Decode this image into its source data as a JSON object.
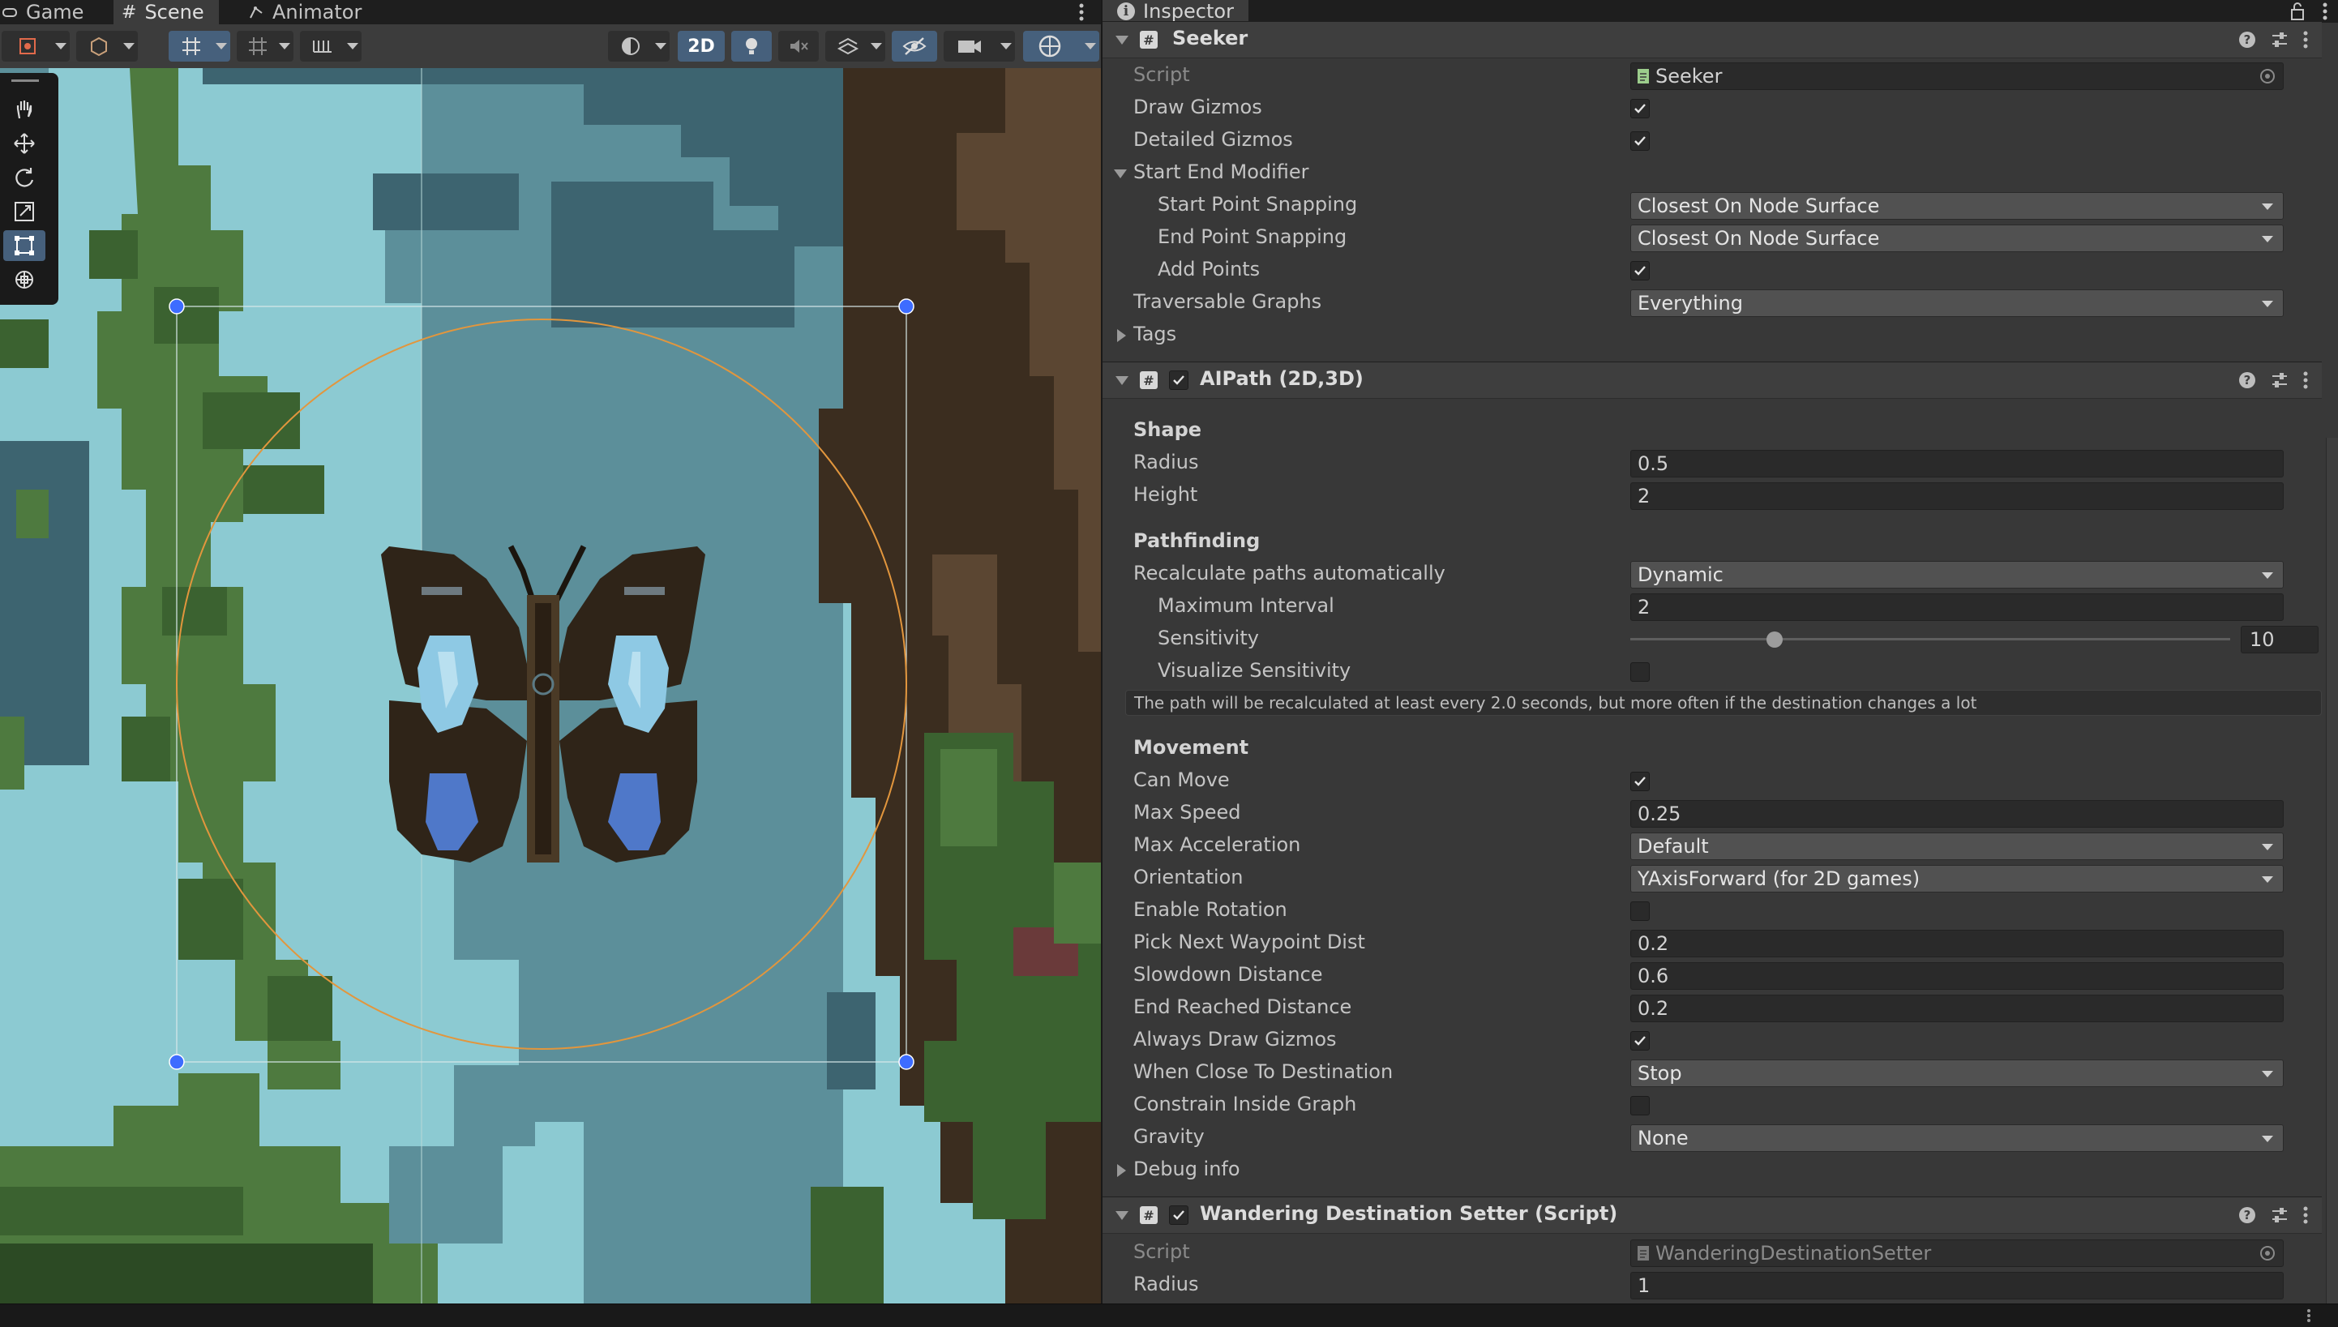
{
  "scene_panel": {
    "tabs": [
      {
        "label": "Game",
        "icon": "gamepad-icon"
      },
      {
        "label": "Scene",
        "icon": "hash-icon"
      },
      {
        "label": "Animator",
        "icon": "animator-icon"
      }
    ],
    "active_tab": "Scene",
    "toolbar": {
      "mode_2d_label": "2D",
      "buttons": [
        "draw-mode-icon",
        "shading-icon",
        "grid-snap-icon",
        "increment-snap-icon",
        "ruler-icon",
        "render-mode-icon",
        "lighting-icon",
        "audio-mute-icon",
        "effects-icon",
        "hidden-objects-icon",
        "camera-icon",
        "gizmos-icon"
      ]
    },
    "tools": [
      "hand-tool-icon",
      "move-tool-icon",
      "rotate-tool-icon",
      "scale-tool-icon",
      "rect-tool-icon",
      "transform-tool-icon"
    ],
    "active_tool": "rect-tool-icon",
    "colors": {
      "sky_light": "#8ccad2",
      "sky_mid": "#5c8f9a",
      "sky_dark": "#3d6470",
      "foliage_light": "#4e7a3f",
      "foliage_mid": "#3b6230",
      "foliage_dark": "#2c4a24",
      "trunk_dark": "#3b2d1f",
      "trunk_mid": "#5b4632",
      "gizmo_circle": "#e2963d",
      "handle_blue": "#3d6cff",
      "wing_light": "#8ec9e4",
      "wing_dark": "#4f78c9",
      "wing_body": "#2f2418"
    }
  },
  "inspector": {
    "tab_label": "Inspector",
    "components": [
      {
        "title": "Seeker",
        "rows": [
          {
            "label": "Script",
            "type": "object",
            "value": "Seeker"
          },
          {
            "label": "Draw Gizmos",
            "type": "checkbox",
            "checked": true
          },
          {
            "label": "Detailed Gizmos",
            "type": "checkbox",
            "checked": true
          },
          {
            "label": "Start End Modifier",
            "type": "foldout",
            "open": true
          },
          {
            "label": "Start Point Snapping",
            "type": "dropdown",
            "value": "Closest On Node Surface",
            "indent": 1
          },
          {
            "label": "End Point Snapping",
            "type": "dropdown",
            "value": "Closest On Node Surface",
            "indent": 1
          },
          {
            "label": "Add Points",
            "type": "checkbox",
            "checked": true,
            "indent": 1
          },
          {
            "label": "Traversable Graphs",
            "type": "dropdown",
            "value": "Everything"
          },
          {
            "label": "Tags",
            "type": "foldout",
            "open": false
          }
        ]
      },
      {
        "title": "AIPath (2D,3D)",
        "enabled": true,
        "sections": [
          {
            "heading": "Shape",
            "rows": [
              {
                "label": "Radius",
                "type": "text",
                "value": "0.5"
              },
              {
                "label": "Height",
                "type": "text",
                "value": "2"
              }
            ]
          },
          {
            "heading": "Pathfinding",
            "rows": [
              {
                "label": "Recalculate paths automatically",
                "type": "dropdown",
                "value": "Dynamic"
              },
              {
                "label": "Maximum Interval",
                "type": "text",
                "value": "2",
                "indent": 1
              },
              {
                "label": "Sensitivity",
                "type": "slider",
                "value": "10",
                "fraction": 0.24,
                "indent": 1
              },
              {
                "label": "Visualize Sensitivity",
                "type": "checkbox",
                "checked": false,
                "indent": 1
              }
            ],
            "help": "The path will be recalculated at least every 2.0 seconds, but more often if the destination changes a lot"
          },
          {
            "heading": "Movement",
            "rows": [
              {
                "label": "Can Move",
                "type": "checkbox",
                "checked": true
              },
              {
                "label": "Max Speed",
                "type": "text",
                "value": "0.25"
              },
              {
                "label": "Max Acceleration",
                "type": "dropdown",
                "value": "Default"
              },
              {
                "label": "Orientation",
                "type": "dropdown",
                "value": "YAxisForward (for 2D games)"
              },
              {
                "label": "Enable Rotation",
                "type": "checkbox",
                "checked": false
              },
              {
                "label": "Pick Next Waypoint Dist",
                "type": "text",
                "value": "0.2"
              },
              {
                "label": "Slowdown Distance",
                "type": "text",
                "value": "0.6"
              },
              {
                "label": "End Reached Distance",
                "type": "text",
                "value": "0.2"
              },
              {
                "label": "Always Draw Gizmos",
                "type": "checkbox",
                "checked": true
              },
              {
                "label": "When Close To Destination",
                "type": "dropdown",
                "value": "Stop"
              },
              {
                "label": "Constrain Inside Graph",
                "type": "checkbox",
                "checked": false
              },
              {
                "label": "Gravity",
                "type": "dropdown",
                "value": "None"
              },
              {
                "label": "Debug info",
                "type": "foldout",
                "open": false
              }
            ]
          }
        ]
      },
      {
        "title": "Wandering Destination Setter (Script)",
        "enabled": true,
        "rows": [
          {
            "label": "Script",
            "type": "object",
            "value": "WanderingDestinationSetter",
            "disabled": true
          },
          {
            "label": "Radius",
            "type": "text",
            "value": "1"
          }
        ]
      }
    ],
    "header_icons": [
      "help-icon",
      "preset-icon",
      "more-icon"
    ]
  }
}
